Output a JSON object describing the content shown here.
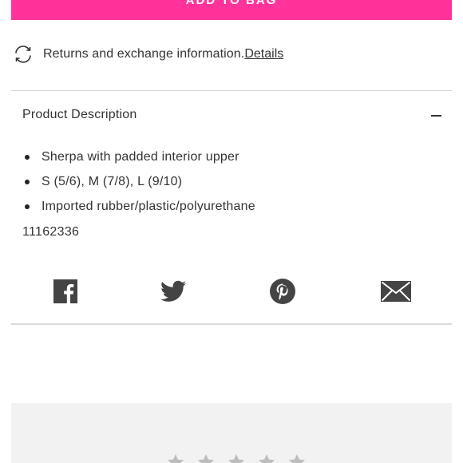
{
  "bag_button": {
    "label": "ADD TO BAG",
    "color": "#ff3399"
  },
  "returns": {
    "text": "Returns and exchange information.",
    "link": "Details",
    "icon": "refresh-icon"
  },
  "description": {
    "title": "Product Description",
    "toggle_icon": "minus-icon",
    "bullets": [
      "Sherpa with padded interior upper",
      "S (5/6), M (7/8), L (9/10)",
      "Imported rubber/plastic/polyurethane"
    ],
    "sku": "11162336"
  },
  "share": {
    "icons": [
      "facebook-icon",
      "twitter-icon",
      "pinterest-icon",
      "email-icon"
    ],
    "icon_color": "#444444"
  },
  "reviews": {
    "star_icon": "star-icon",
    "star_color": "#bdbdbd",
    "panel_color": "#f2f2f2"
  }
}
